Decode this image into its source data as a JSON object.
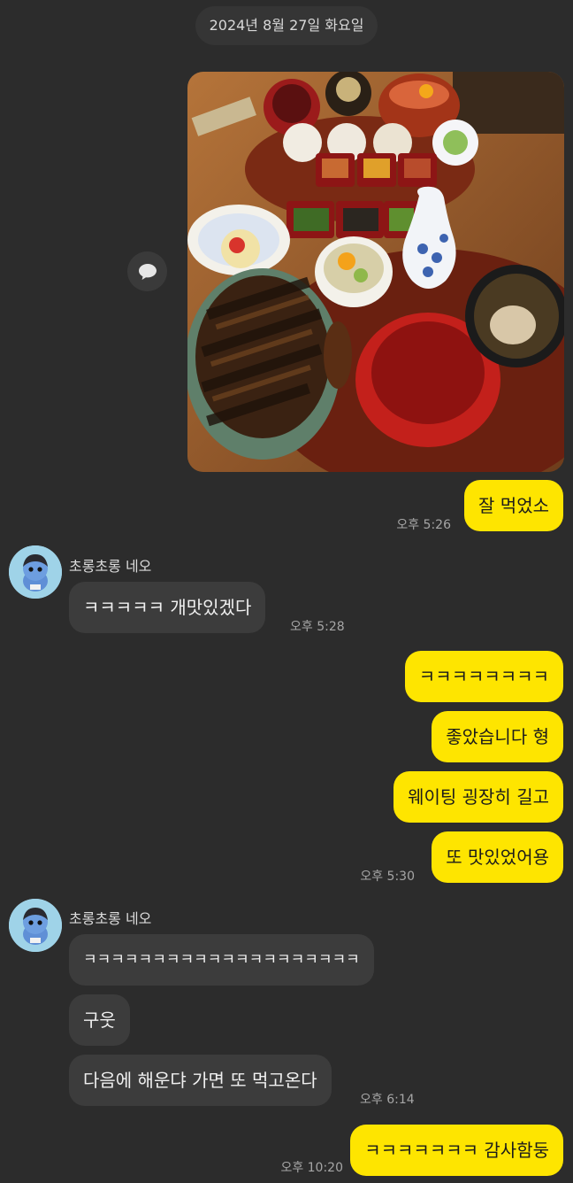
{
  "date_divider": "2024년 8월 27일 화요일",
  "photo": {
    "description_icon": "food-photo"
  },
  "messages": {
    "m1": {
      "text": "잘 먹었소",
      "time": "오후 5:26"
    },
    "g1": {
      "sender": "초롱초롱 네오",
      "m1": {
        "text": "ㅋㅋㅋㅋㅋ 개맛있겠다",
        "time": "오후 5:28"
      }
    },
    "m2": {
      "text": "ㅋㅋㅋㅋㅋㅋㅋㅋ"
    },
    "m3": {
      "text": "좋았습니다 형"
    },
    "m4": {
      "text": "웨이팅 굉장히 길고"
    },
    "m5": {
      "text": "또 맛있었어용",
      "time": "오후 5:30"
    },
    "g2": {
      "sender": "초롱초롱 네오",
      "m1": {
        "text": "ㅋㅋㅋㅋㅋㅋㅋㅋㅋㅋㅋㅋㅋㅋㅋㅋㅋㅋㅋㅋ"
      },
      "m2": {
        "text": "구웃"
      },
      "m3": {
        "text": "다음에 해운댜 가면 또 먹고온다",
        "time": "오후 6:14"
      }
    },
    "m6": {
      "text": "ㅋㅋㅋㅋㅋㅋㅋ 감사함둥",
      "time": "오후 10:20"
    }
  },
  "colors": {
    "background": "#2c2c2c",
    "my_bubble": "#fee500",
    "their_bubble": "#3c3c3c",
    "avatar_bg": "#9fd3e8"
  }
}
